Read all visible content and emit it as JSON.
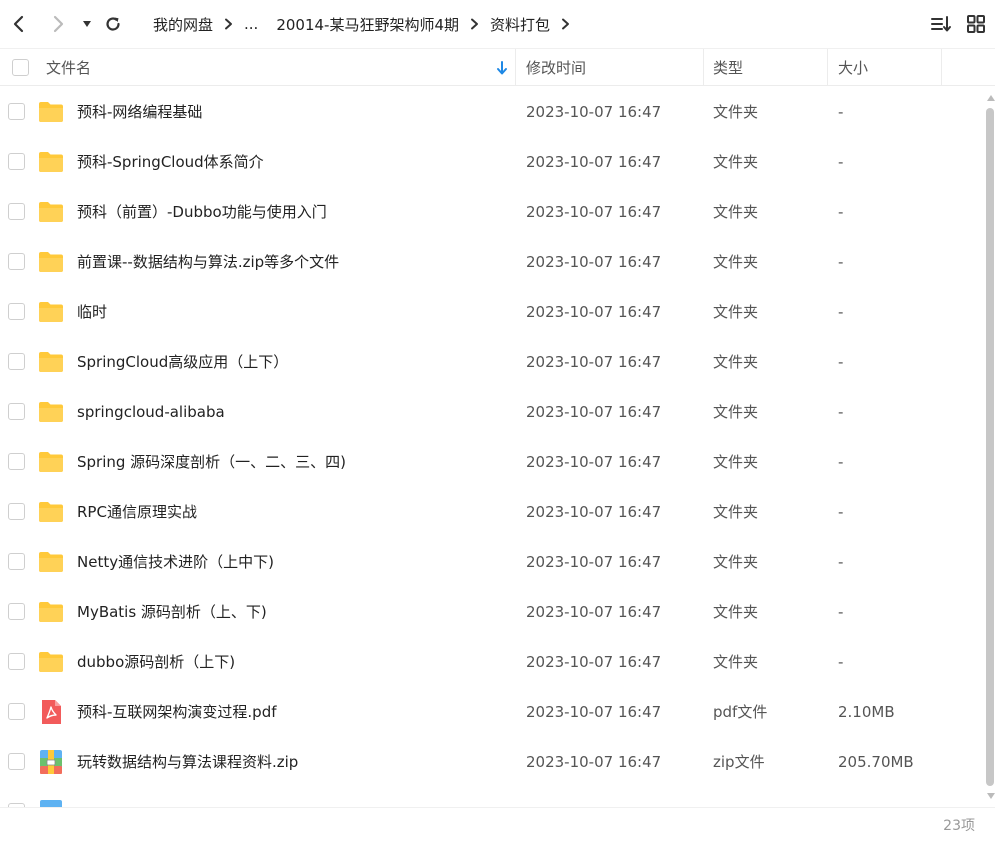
{
  "breadcrumb": [
    "我的网盘",
    "...",
    "20014-某马狂野架构师4期",
    "资料打包"
  ],
  "columns": {
    "name": "文件名",
    "modified": "修改时间",
    "type": "类型",
    "size": "大小"
  },
  "files": [
    {
      "name": "预科-网络编程基础",
      "time": "2023-10-07 16:47",
      "type": "文件夹",
      "size": "-",
      "icon": "folder-icon"
    },
    {
      "name": "预科-SpringCloud体系简介",
      "time": "2023-10-07 16:47",
      "type": "文件夹",
      "size": "-",
      "icon": "folder-icon"
    },
    {
      "name": "预科（前置）-Dubbo功能与使用入门",
      "time": "2023-10-07 16:47",
      "type": "文件夹",
      "size": "-",
      "icon": "folder-icon"
    },
    {
      "name": "前置课--数据结构与算法.zip等多个文件",
      "time": "2023-10-07 16:47",
      "type": "文件夹",
      "size": "-",
      "icon": "folder-icon"
    },
    {
      "name": "临时",
      "time": "2023-10-07 16:47",
      "type": "文件夹",
      "size": "-",
      "icon": "folder-icon"
    },
    {
      "name": "SpringCloud高级应用（上下）",
      "time": "2023-10-07 16:47",
      "type": "文件夹",
      "size": "-",
      "icon": "folder-icon"
    },
    {
      "name": "springcloud-alibaba",
      "time": "2023-10-07 16:47",
      "type": "文件夹",
      "size": "-",
      "icon": "folder-icon"
    },
    {
      "name": "Spring 源码深度剖析（一、二、三、四)",
      "time": "2023-10-07 16:47",
      "type": "文件夹",
      "size": "-",
      "icon": "folder-icon"
    },
    {
      "name": "RPC通信原理实战",
      "time": "2023-10-07 16:47",
      "type": "文件夹",
      "size": "-",
      "icon": "folder-icon"
    },
    {
      "name": "Netty通信技术进阶（上中下)",
      "time": "2023-10-07 16:47",
      "type": "文件夹",
      "size": "-",
      "icon": "folder-icon"
    },
    {
      "name": "MyBatis 源码剖析（上、下)",
      "time": "2023-10-07 16:47",
      "type": "文件夹",
      "size": "-",
      "icon": "folder-icon"
    },
    {
      "name": "dubbo源码剖析（上下)",
      "time": "2023-10-07 16:47",
      "type": "文件夹",
      "size": "-",
      "icon": "folder-icon"
    },
    {
      "name": "预科-互联网架构演变过程.pdf",
      "time": "2023-10-07 16:47",
      "type": "pdf文件",
      "size": "2.10MB",
      "icon": "pdf-icon"
    },
    {
      "name": "玩转数据结构与算法课程资料.zip",
      "time": "2023-10-07 16:47",
      "type": "zip文件",
      "size": "205.70MB",
      "icon": "zip-icon"
    }
  ],
  "footer": {
    "count": "23项"
  },
  "colors": {
    "folder": "#FFC93A",
    "pdf": "#F25B5B",
    "sort_arrow": "#1E88E5"
  }
}
